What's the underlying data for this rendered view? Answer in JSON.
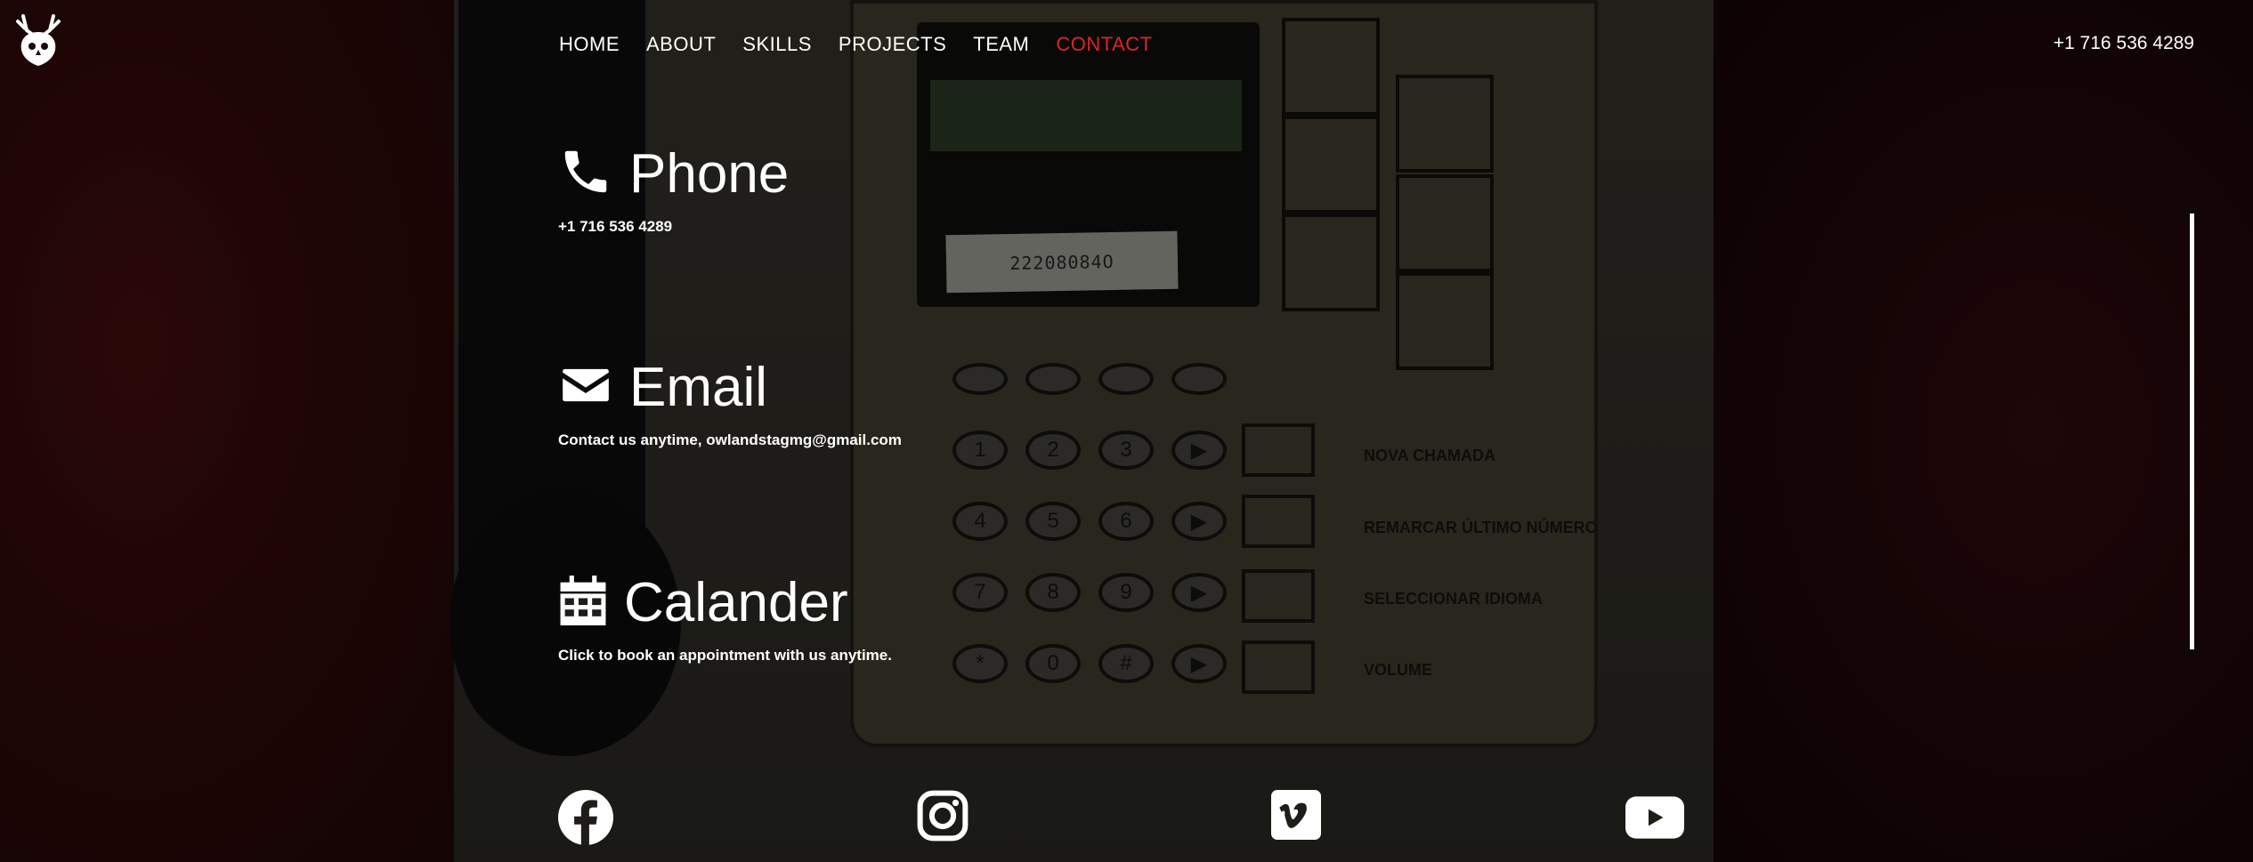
{
  "header": {
    "logo_icon": "stag-owl-logo-icon",
    "nav": [
      {
        "label": "HOME",
        "active": false
      },
      {
        "label": "ABOUT",
        "active": false
      },
      {
        "label": "SKILLS",
        "active": false
      },
      {
        "label": "PROJECTS",
        "active": false
      },
      {
        "label": "TEAM",
        "active": false
      },
      {
        "label": "CONTACT",
        "active": true
      }
    ],
    "phone": "+1 716 536 4289"
  },
  "contact": {
    "phone": {
      "icon": "phone-icon",
      "title": "Phone",
      "text": "+1 716 536 4289"
    },
    "email": {
      "icon": "envelope-icon",
      "title": "Email",
      "text": "Contact us anytime, owlandstagmg@gmail.com"
    },
    "calendar": {
      "icon": "calendar-icon",
      "title": "Calander",
      "text": "Click to book an appointment with us anytime."
    }
  },
  "background": {
    "phone_label": "22208084O",
    "phone_keys": [
      "1",
      "2",
      "3",
      "4",
      "5",
      "6",
      "7",
      "8",
      "9",
      "*",
      "0",
      "#"
    ],
    "phone_functions": [
      "NOVA CHAMADA",
      "REMARCAR ÚLTIMO NÚMERO",
      "SELECCIONAR IDIOMA",
      "VOLUME"
    ]
  },
  "social": [
    {
      "icon": "facebook-icon"
    },
    {
      "icon": "instagram-icon"
    },
    {
      "icon": "vimeo-icon"
    },
    {
      "icon": "youtube-icon"
    }
  ],
  "colors": {
    "accent": "#e0222a",
    "text": "#ffffff"
  }
}
